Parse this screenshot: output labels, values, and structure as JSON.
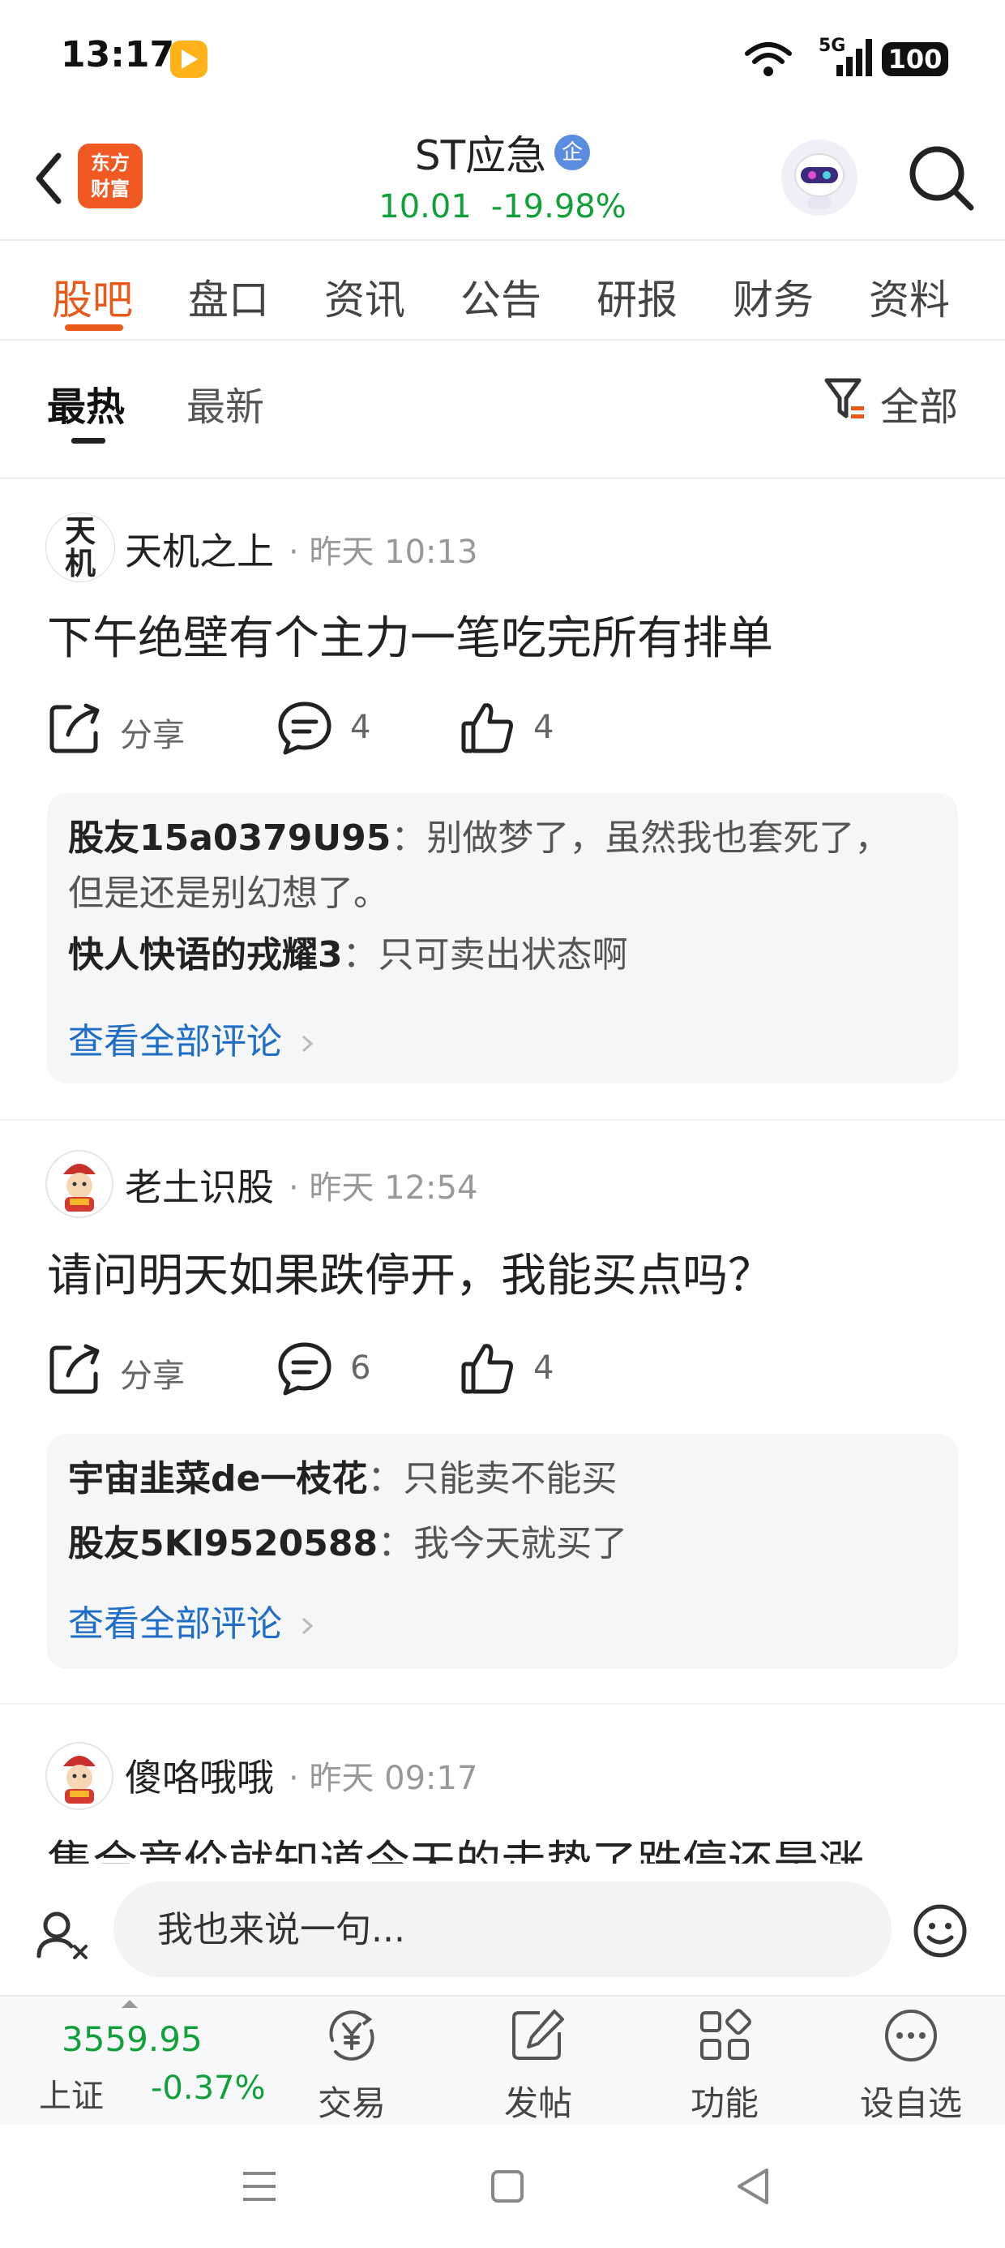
{
  "status_bar": {
    "time": "13:17",
    "network": "5G",
    "battery": "100",
    "icons": [
      "video-app-icon",
      "wifi-icon",
      "signal-icon",
      "battery-icon"
    ]
  },
  "header": {
    "brand_logo_text": "东方财富",
    "stock_name": "ST应急",
    "enterprise_badge": "企",
    "price": "10.01",
    "change_percent": "-19.98%",
    "price_color": "#12a03a",
    "icons": [
      "back-arrow-icon",
      "robot-avatar-icon",
      "search-icon"
    ]
  },
  "tabs": [
    {
      "label": "股吧",
      "active": true
    },
    {
      "label": "盘口",
      "active": false
    },
    {
      "label": "资讯",
      "active": false
    },
    {
      "label": "公告",
      "active": false
    },
    {
      "label": "研报",
      "active": false
    },
    {
      "label": "财务",
      "active": false
    },
    {
      "label": "资料",
      "active": false
    }
  ],
  "accent_color": "#e8591a",
  "subtabs": {
    "hot": "最热",
    "latest": "最新",
    "filter_label": "全部"
  },
  "posts": [
    {
      "author": "天机之上",
      "avatar_text": "天机",
      "time": "· 昨天 10:13",
      "text": "下午绝壁有个主力一笔吃完所有排单",
      "share_label": "分享",
      "comment_count": "4",
      "like_count": "4",
      "comments": [
        {
          "user": "股友15a0379U95",
          "text": "：别做梦了，虽然我也套死了，",
          "text_cont": "但是还是别幻想了。"
        },
        {
          "user": "快人快语的戎耀3",
          "text": "：只可卖出状态啊"
        }
      ],
      "view_all": "查看全部评论"
    },
    {
      "author": "老土识股",
      "time": "· 昨天 12:54",
      "text": "请问明天如果跌停开，我能买点吗？",
      "share_label": "分享",
      "comment_count": "6",
      "like_count": "4",
      "comments": [
        {
          "user": "宇宙韭菜de一枝花",
          "text": "：只能卖不能买"
        },
        {
          "user": "股友5Kl9520588",
          "text": "：我今天就买了"
        }
      ],
      "view_all": "查看全部评论"
    },
    {
      "author": "傻咯哦哦",
      "time": "· 昨天 09:17",
      "text": "集合竞价就知道今天的走势了跌停还是涨"
    }
  ],
  "input_bar": {
    "placeholder": "我也来说一句..."
  },
  "bottom_toolbar": {
    "index_value": "3559.95",
    "index_name": "上证",
    "index_change": "-0.37%",
    "items": [
      {
        "label": "交易",
        "icon": "yuan-refresh-icon"
      },
      {
        "label": "发帖",
        "icon": "edit-post-icon"
      },
      {
        "label": "功能",
        "icon": "grid-apps-icon"
      },
      {
        "label": "设自选",
        "icon": "more-dots-icon"
      }
    ]
  },
  "nav_bar": {
    "icons": [
      "menu-icon",
      "home-square-icon",
      "back-triangle-icon"
    ]
  }
}
